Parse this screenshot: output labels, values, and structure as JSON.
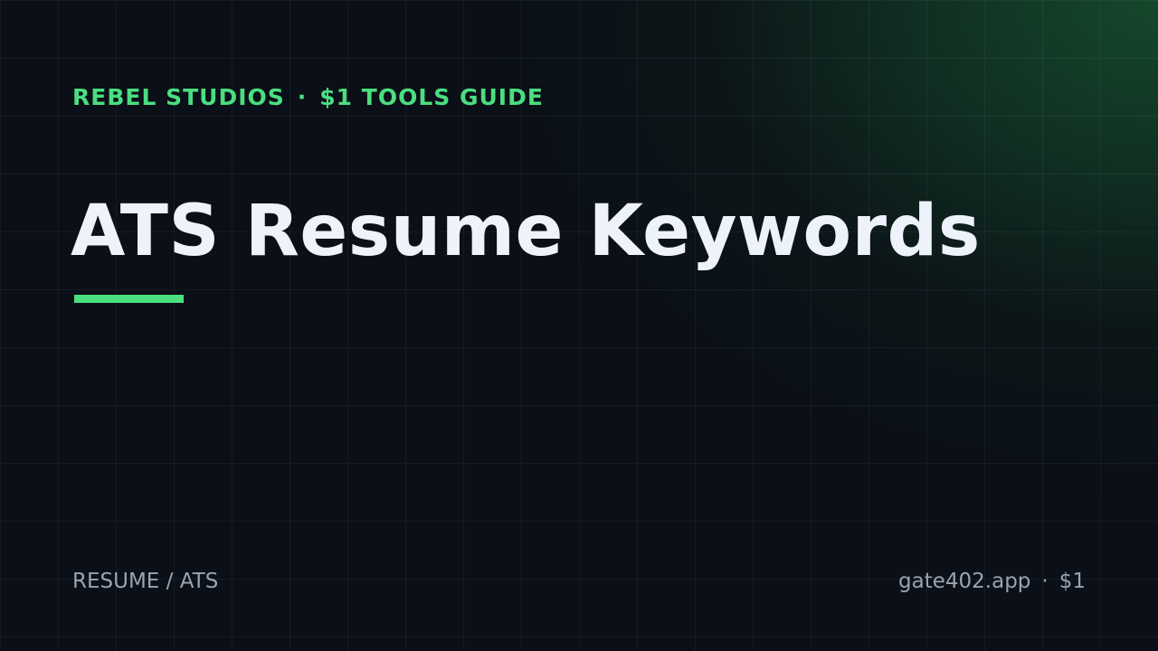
{
  "header": {
    "brand": "REBEL STUDIOS",
    "separator": "·",
    "series": "$1 TOOLS GUIDE"
  },
  "title": "ATS Resume Keywords",
  "footer": {
    "category": "RESUME / ATS",
    "site": "gate402.app",
    "separator": "·",
    "price": "$1"
  },
  "colors": {
    "background": "#0b0f17",
    "accent": "#4ade80",
    "title": "#eef2fb",
    "muted": "#9aa3b2",
    "glow": "#16502e"
  }
}
